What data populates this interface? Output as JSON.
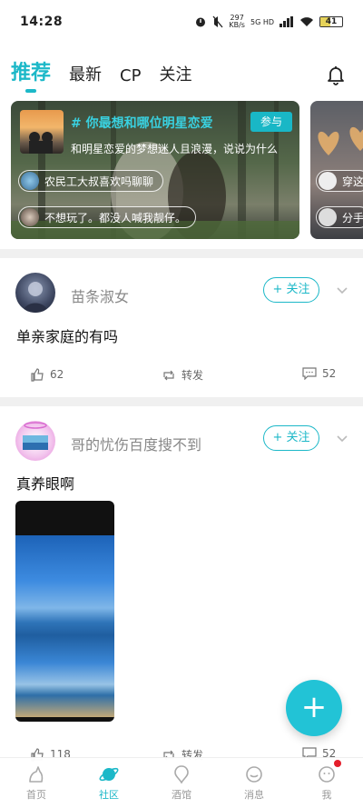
{
  "status": {
    "time": "14:28",
    "speed_value": "297",
    "speed_unit": "KB/s",
    "net": "5G HD",
    "battery": "41"
  },
  "tabs": [
    {
      "label": "推荐",
      "active": true
    },
    {
      "label": "最新"
    },
    {
      "label": "CP"
    },
    {
      "label": "关注"
    }
  ],
  "banner": {
    "title": "# 你最想和哪位明星恋爱",
    "join_label": "参与",
    "desc": "和明星恋爱的梦想迷人且浪漫，说说为什么",
    "chips": [
      "农民工大叔喜欢吗聊聊",
      "不想玩了。都没人喊我靓仔。"
    ]
  },
  "banner2": {
    "chips": [
      "穿这",
      "分手"
    ]
  },
  "posts": [
    {
      "user": "苗条淑女",
      "follow_label": "+ 关注",
      "text": "单亲家庭的有吗",
      "likes": "62",
      "repost": "转发",
      "comments": "52"
    },
    {
      "user": "哥的忧伤百度搜不到",
      "follow_label": "+ 关注",
      "text": "真养眼啊",
      "likes": "118",
      "repost": "转发",
      "comments": "52"
    }
  ],
  "fab_label": "+",
  "nav": [
    {
      "label": "首页",
      "icon": "home-icon"
    },
    {
      "label": "社区",
      "icon": "planet-icon",
      "active": true
    },
    {
      "label": "酒馆",
      "icon": "tavern-icon"
    },
    {
      "label": "消息",
      "icon": "message-icon"
    },
    {
      "label": "我",
      "icon": "profile-icon"
    }
  ],
  "colors": {
    "accent": "#1cb8c8",
    "badge": "#e41e2b"
  }
}
